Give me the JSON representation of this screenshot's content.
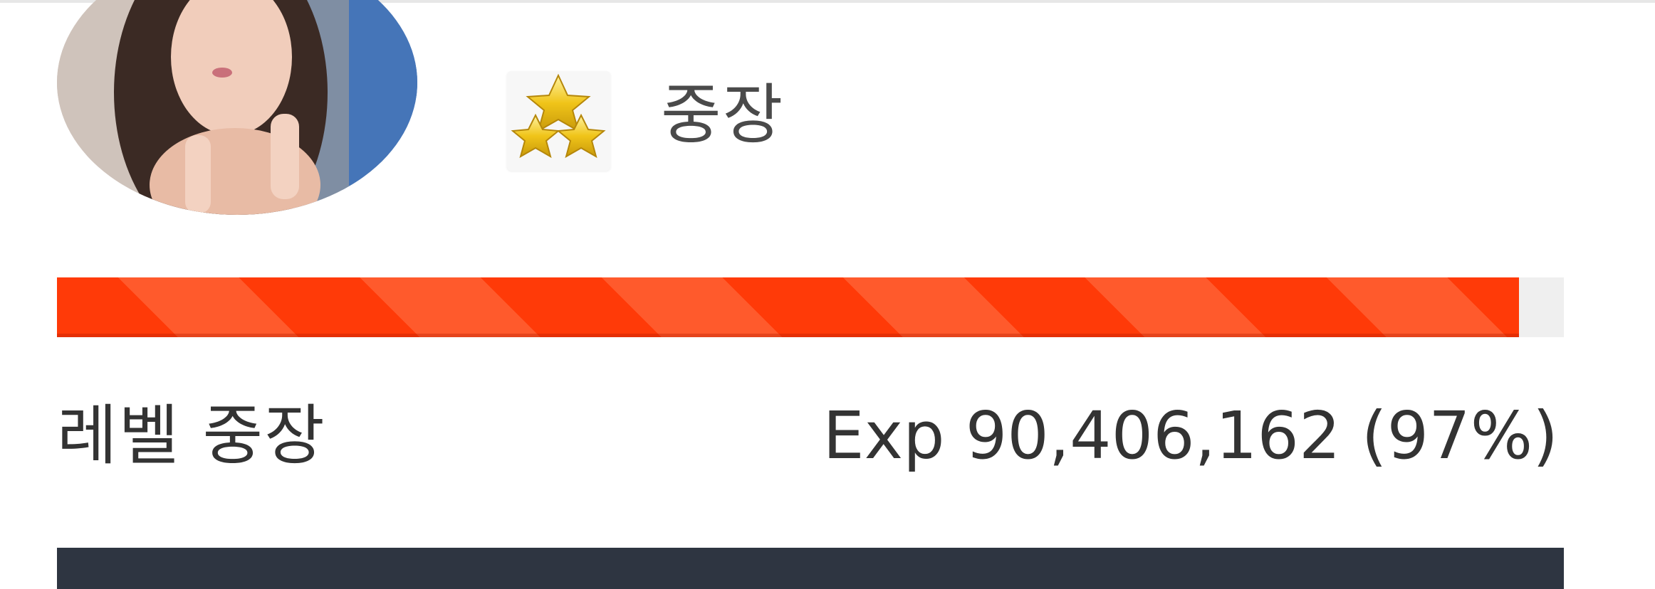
{
  "profile": {
    "rank_title": "중장",
    "rank_icon": "three-gold-stars-icon"
  },
  "level": {
    "label": "레벨 중장",
    "exp_text": "Exp 90,406,162 (97%)",
    "progress_fraction": 0.97
  },
  "colors": {
    "progress_fill": "#ff3a08",
    "progress_stripe": "#ff5a2c",
    "progress_track": "#efefef",
    "bottom_bar": "#2e3541",
    "star_gold": "#f0c419"
  }
}
